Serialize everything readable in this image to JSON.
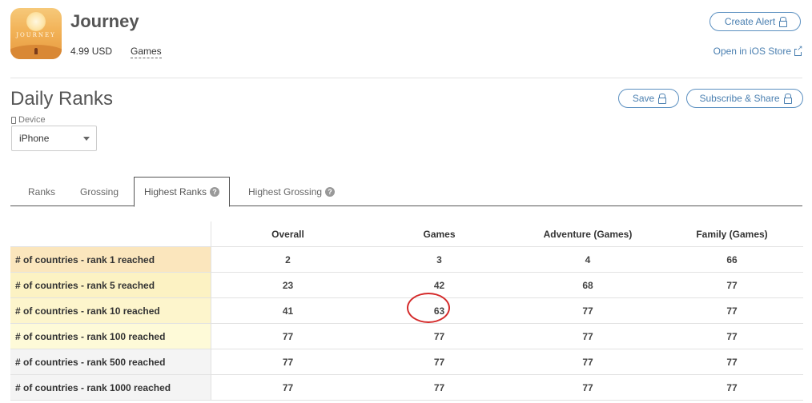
{
  "app": {
    "title": "Journey",
    "price": "4.99 USD",
    "category": "Games",
    "icon_wordmark": "JOURNEY",
    "create_alert_label": "Create Alert",
    "store_link_label": "Open in iOS Store"
  },
  "section": {
    "title": "Daily Ranks",
    "save_label": "Save",
    "subscribe_label": "Subscribe & Share",
    "device_label": "Device",
    "device_value": "iPhone"
  },
  "tabs": [
    {
      "label": "Ranks",
      "active": false,
      "help": false
    },
    {
      "label": "Grossing",
      "active": false,
      "help": false
    },
    {
      "label": "Highest Ranks",
      "active": true,
      "help": true
    },
    {
      "label": "Highest Grossing",
      "active": false,
      "help": true
    }
  ],
  "table": {
    "columns": [
      "Overall",
      "Games",
      "Adventure (Games)",
      "Family (Games)"
    ],
    "rows": [
      {
        "label": "# of countries - rank 1 reached",
        "values": [
          "2",
          "3",
          "4",
          "66"
        ],
        "color": "#fbe6bd"
      },
      {
        "label": "# of countries - rank 5 reached",
        "values": [
          "23",
          "42",
          "68",
          "77"
        ],
        "color": "#fcf2c3"
      },
      {
        "label": "# of countries - rank 10 reached",
        "values": [
          "41",
          "63",
          "77",
          "77"
        ],
        "color": "#fdf5cc"
      },
      {
        "label": "# of countries - rank 100 reached",
        "values": [
          "77",
          "77",
          "77",
          "77"
        ],
        "color": "#fefad8"
      },
      {
        "label": "# of countries - rank 500 reached",
        "values": [
          "77",
          "77",
          "77",
          "77"
        ],
        "color": "#f4f4f4"
      },
      {
        "label": "# of countries - rank 1000 reached",
        "values": [
          "77",
          "77",
          "77",
          "77"
        ],
        "color": "#f4f4f4"
      }
    ]
  },
  "colors": {
    "accent": "#4a7fb0",
    "highlight_circle": "#d42a2a"
  }
}
